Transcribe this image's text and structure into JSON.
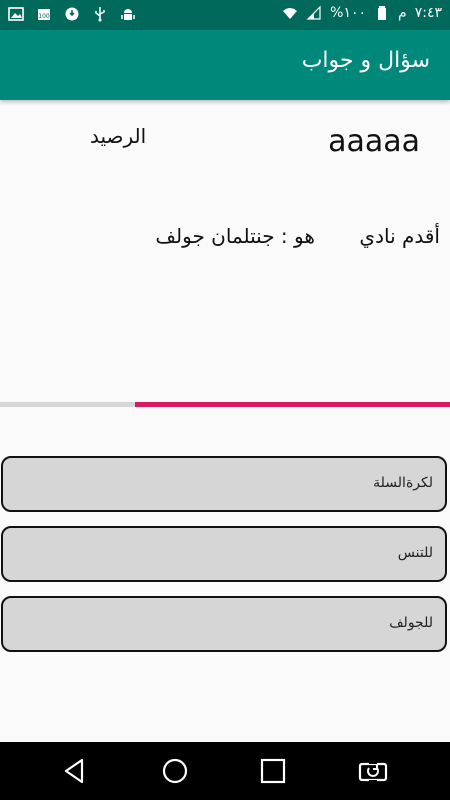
{
  "status_bar": {
    "time": "٧:٤٣",
    "ampm": "م",
    "battery_percent": "%١٠٠",
    "left_icons": [
      "gallery-icon",
      "battery-100-icon",
      "data-saver-icon",
      "usb-icon",
      "android-debug-icon"
    ],
    "right_icons": [
      "wifi-icon",
      "signal-icon",
      "battery-icon"
    ]
  },
  "app_bar": {
    "title": "سؤال و جواب"
  },
  "score": {
    "value": "aaaaa",
    "label": "الرصيد"
  },
  "question": {
    "text": "أقدم نادي       هو : جنتلمان جولف"
  },
  "progress": {
    "fraction": 0.7,
    "track_color": "#d6d6d6",
    "fill_color": "#d81b60"
  },
  "answers": [
    {
      "label": "لكرةالسلة"
    },
    {
      "label": "للتنس"
    },
    {
      "label": "للجولف"
    }
  ],
  "colors": {
    "status_bar": "#00695c",
    "app_bar": "#00897b",
    "button_bg": "#d6d6d6"
  },
  "nav_bar": {
    "icons": [
      "back-icon",
      "home-icon",
      "recents-icon",
      "rotate-icon"
    ]
  }
}
